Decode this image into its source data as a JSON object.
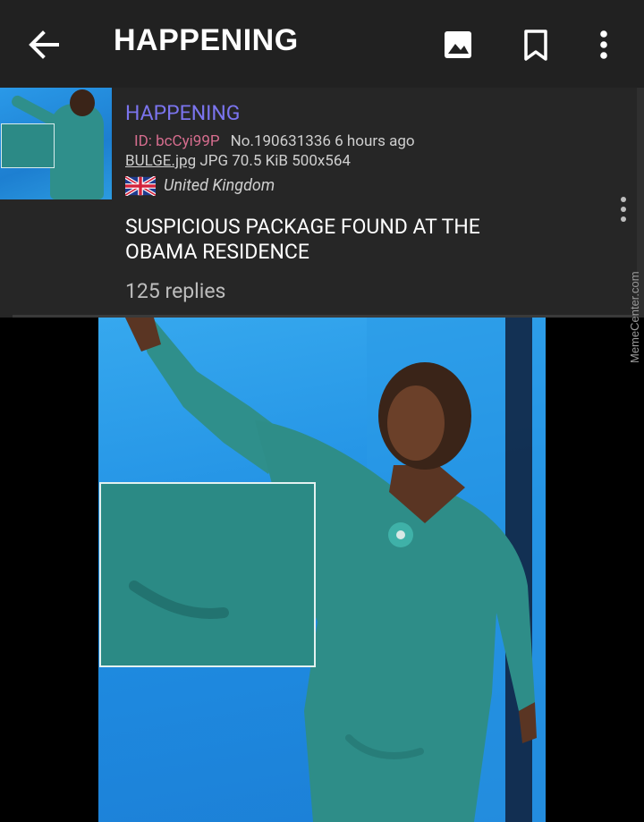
{
  "appbar": {
    "title": "HAPPENING",
    "icons": [
      "back-arrow-icon",
      "image-icon",
      "bookmark-icon",
      "more-vert-icon"
    ]
  },
  "post": {
    "thread_title": "HAPPENING",
    "poster_id": "ID: bcCyi99P",
    "post_number_time": "No.190631336 6 hours ago",
    "file_name": "BULGE.jpg",
    "file_info": " JPG 70.5 KiB 500x564",
    "country": "United Kingdom",
    "subject": "SUSPICIOUS PACKAGE FOUND AT THE OBAMA RESIDENCE",
    "replies": "125 replies"
  },
  "watermark": "MemeCenter.com",
  "colors": {
    "appbar_bg": "#212121",
    "card_bg": "#262626",
    "title_accent": "#7b74ee",
    "poster_id": "#d66d8e"
  }
}
